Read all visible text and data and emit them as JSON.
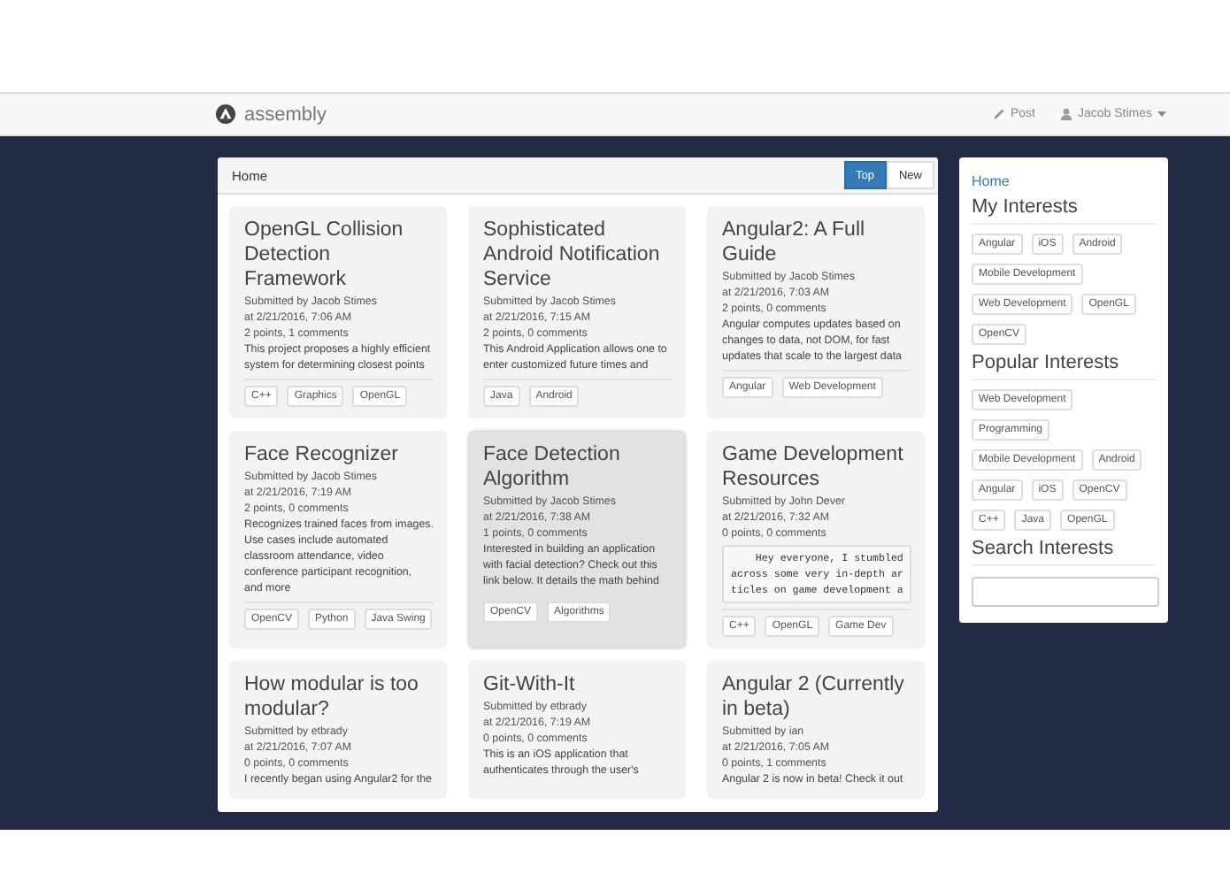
{
  "navbar": {
    "brand": "assembly",
    "links": [
      {
        "kind": "post",
        "label": "Post"
      },
      {
        "kind": "user",
        "label": "Jacob Stimes"
      }
    ]
  },
  "feed": {
    "title": "Home",
    "sort": [
      {
        "label": "Top",
        "selected": true
      },
      {
        "label": "New",
        "selected": false
      }
    ],
    "cards": [
      {
        "title": "OpenGL Collision Detection Framework",
        "author": "Submitted by Jacob Stimes",
        "time": "at 2/21/2016, 7:06 AM",
        "stats": "2 points, 1 comments",
        "highlighted": false,
        "body": {
          "kind": "text",
          "lines": [
            "This project proposes a highly efficient",
            "system for determining closest points"
          ]
        },
        "tags": [
          "C++",
          "Graphics",
          "OpenGL"
        ]
      },
      {
        "title": "Sophisticated Android Notification Service",
        "author": "Submitted by Jacob Stimes",
        "time": "at 2/21/2016, 7:15 AM",
        "stats": "2 points, 0 comments",
        "highlighted": false,
        "body": {
          "kind": "text",
          "lines": [
            "This Android Application allows one to",
            "enter customized future times and"
          ]
        },
        "tags": [
          "Java",
          "Android"
        ]
      },
      {
        "title": "Angular2: A Full Guide",
        "author": "Submitted by Jacob Stimes",
        "time": "at 2/21/2016, 7:03 AM",
        "stats": "2 points, 0 comments",
        "highlighted": false,
        "body": {
          "kind": "text",
          "lines": [
            "Angular computes updates based on",
            "changes to data, not DOM, for fast",
            "updates that scale to the largest data"
          ]
        },
        "tags": [
          "Angular",
          "Web Development"
        ]
      },
      {
        "title": "Face Recognizer",
        "author": "Submitted by Jacob Stimes",
        "time": "at 2/21/2016, 7:19 AM",
        "stats": "2 points, 0 comments",
        "highlighted": false,
        "body": {
          "kind": "text",
          "lines": [
            "Recognizes trained faces from images.",
            "Use cases include automated",
            "classroom attendance, video",
            "conference participant recognition,",
            "and more"
          ]
        },
        "tags": [
          "OpenCV",
          "Python",
          "Java Swing"
        ]
      },
      {
        "title": "Face Detection Algorithm",
        "author": "Submitted by Jacob Stimes",
        "time": "at 2/21/2016, 7:38 AM",
        "stats": "1 points, 0 comments",
        "highlighted": true,
        "body": {
          "kind": "text",
          "lines": [
            "Interested in building an application",
            "with facial detection? Check out this",
            "link below. It details the math behind"
          ]
        },
        "tags": [
          "OpenCV",
          "Algorithms"
        ]
      },
      {
        "title": "Game Development Resources",
        "author": "Submitted by John Dever",
        "time": "at 2/21/2016, 7:32 AM",
        "stats": "0 points, 0 comments",
        "highlighted": false,
        "body": {
          "kind": "code",
          "lines": [
            "    Hey everyone, I stumbled",
            "across some very in-depth ar",
            "ticles on game development a"
          ]
        },
        "tags": [
          "C++",
          "OpenGL",
          "Game Dev"
        ]
      },
      {
        "title": "How modular is too modular?",
        "author": "Submitted by etbrady",
        "time": "at 2/21/2016, 7:07 AM",
        "stats": "0 points, 0 comments",
        "highlighted": false,
        "body": {
          "kind": "text",
          "lines": [
            "I recently began using Angular2 for the"
          ]
        }
      },
      {
        "title": "Git-With-It",
        "author": "Submitted by etbrady",
        "time": "at 2/21/2016, 7:19 AM",
        "stats": "0 points, 0 comments",
        "highlighted": false,
        "body": {
          "kind": "text",
          "lines": [
            "This is an iOS application that",
            "authenticates through the user's"
          ]
        }
      },
      {
        "title": "Angular 2 (Currently in beta)",
        "author": "Submitted by ian",
        "time": "at 2/21/2016, 7:05 AM",
        "stats": "0 points, 1 comments",
        "highlighted": false,
        "body": {
          "kind": "text",
          "lines": [
            "Angular 2 is now in beta! Check it out"
          ]
        }
      }
    ]
  },
  "sidebar": {
    "link": "Home",
    "sections": [
      {
        "heading": "My Interests",
        "tags": [
          "Angular",
          "iOS",
          "Android",
          "Mobile Development",
          "Web Development",
          "OpenGL",
          "OpenCV"
        ]
      },
      {
        "heading": "Popular Interests",
        "tags": [
          "Web Development",
          "Programming",
          "Mobile Development",
          "Android",
          "Angular",
          "iOS",
          "OpenCV",
          "C++",
          "Java",
          "OpenGL"
        ]
      }
    ],
    "search": {
      "heading": "Search Interests"
    }
  }
}
